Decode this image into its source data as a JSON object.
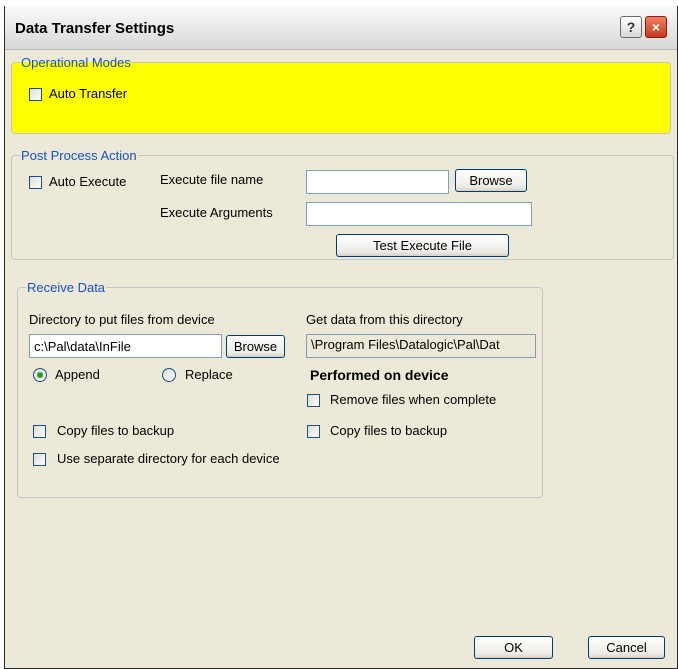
{
  "window": {
    "title": "Data Transfer Settings",
    "help_label": "?",
    "close_label": "×"
  },
  "operational_modes": {
    "legend": "Operational Modes",
    "auto_transfer_label": "Auto Transfer",
    "highlight_color": "#ffff00"
  },
  "post_process": {
    "legend": "Post Process Action",
    "auto_execute_label": "Auto Execute",
    "execute_file_name_label": "Execute file name",
    "execute_file_name_value": "",
    "browse_label": "Browse",
    "execute_arguments_label": "Execute Arguments",
    "execute_arguments_value": "",
    "test_button_label": "Test Execute File"
  },
  "receive_data": {
    "legend": "Receive Data",
    "dir_label": "Directory to put files from device",
    "dir_value": "c:\\Pal\\data\\InFile",
    "browse_label": "Browse",
    "get_data_label": "Get data from this directory",
    "get_data_value": "\\Program Files\\Datalogic\\Pal\\Dat",
    "append_label": "Append",
    "replace_label": "Replace",
    "performed_label": "Performed on device",
    "remove_files_label": "Remove files when complete",
    "copy_backup_left_label": "Copy files to backup",
    "copy_backup_right_label": "Copy files to backup",
    "separate_dir_label": "Use separate directory for each device"
  },
  "footer": {
    "ok_label": "OK",
    "cancel_label": "Cancel"
  }
}
